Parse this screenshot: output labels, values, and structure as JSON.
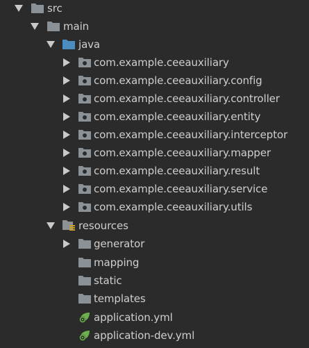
{
  "tree": {
    "items": [
      {
        "label": "src",
        "expanded": true,
        "kind": "folder"
      },
      {
        "label": "main",
        "expanded": true,
        "kind": "folder"
      },
      {
        "label": "java",
        "expanded": true,
        "kind": "source-root"
      },
      {
        "label": "com.example.ceeauxiliary",
        "expanded": false,
        "kind": "package"
      },
      {
        "label": "com.example.ceeauxiliary.config",
        "expanded": false,
        "kind": "package"
      },
      {
        "label": "com.example.ceeauxiliary.controller",
        "expanded": false,
        "kind": "package"
      },
      {
        "label": "com.example.ceeauxiliary.entity",
        "expanded": false,
        "kind": "package"
      },
      {
        "label": "com.example.ceeauxiliary.interceptor",
        "expanded": false,
        "kind": "package"
      },
      {
        "label": "com.example.ceeauxiliary.mapper",
        "expanded": false,
        "kind": "package"
      },
      {
        "label": "com.example.ceeauxiliary.result",
        "expanded": false,
        "kind": "package"
      },
      {
        "label": "com.example.ceeauxiliary.service",
        "expanded": false,
        "kind": "package"
      },
      {
        "label": "com.example.ceeauxiliary.utils",
        "expanded": false,
        "kind": "package"
      },
      {
        "label": "resources",
        "expanded": true,
        "kind": "resources-root"
      },
      {
        "label": "generator",
        "expanded": false,
        "kind": "folder"
      },
      {
        "label": "mapping",
        "kind": "folder"
      },
      {
        "label": "static",
        "kind": "folder"
      },
      {
        "label": "templates",
        "kind": "folder"
      },
      {
        "label": "application.yml",
        "kind": "spring-yml"
      },
      {
        "label": "application-dev.yml",
        "kind": "spring-yml"
      }
    ]
  },
  "colors": {
    "background": "#2b2b2b",
    "text": "#cfcfcf",
    "folder": "#8b9297",
    "source_folder": "#4a8dbe",
    "arrow": "#c9c9c9",
    "spring_green": "#6ab04c",
    "resources_stripe": "#c9a227"
  }
}
